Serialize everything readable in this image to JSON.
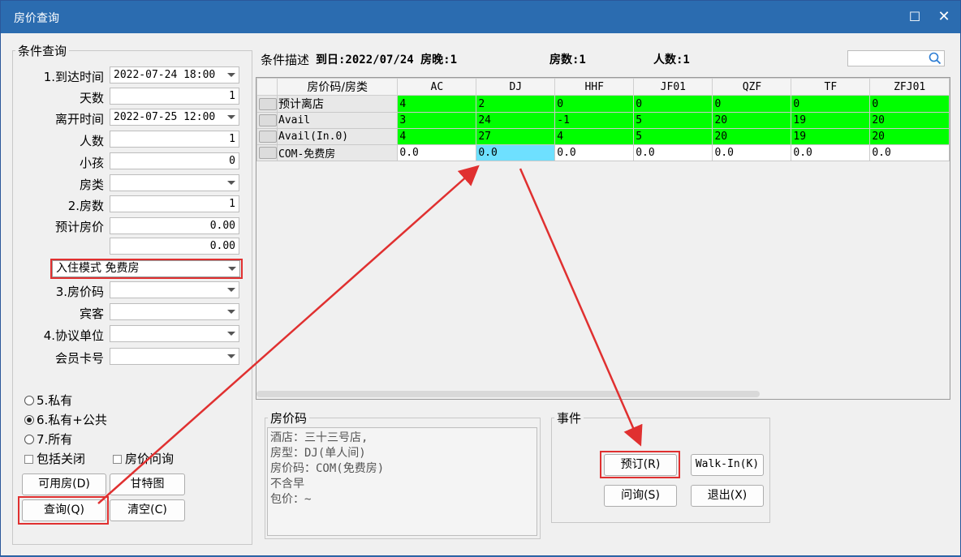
{
  "window": {
    "title": "房价查询"
  },
  "query": {
    "legend": "条件查询",
    "arrival_label": "1.到达时间",
    "arrival_value": "2022-07-24 18:00",
    "days_label": "天数",
    "days_value": "1",
    "depart_label": "离开时间",
    "depart_value": "2022-07-25 12:00",
    "persons_label": "人数",
    "persons_value": "1",
    "children_label": "小孩",
    "children_value": "0",
    "roomtype_label": "房类",
    "roomtype_value": "",
    "rooms_label": "2.房数",
    "rooms_value": "1",
    "estprice_label": "预计房价",
    "estprice_value": "0.00",
    "estprice2_value": "0.00",
    "checkin_mode": "入住模式 免费房",
    "ratecode_label": "3.房价码",
    "guest_label": "宾客",
    "agreement_label": "4.协议单位",
    "member_label": "会员卡号",
    "radio_private": "5.私有",
    "radio_private_public": "6.私有+公共",
    "radio_all": "7.所有",
    "chk_include_closed": "包括关闭",
    "chk_rate_query": "房价问询",
    "btn_available": "可用房(D)",
    "btn_gantt": "甘特图",
    "btn_query": "查询(Q)",
    "btn_clear": "清空(C)"
  },
  "condition": {
    "prefix": "条件描述",
    "desc": "到日:2022/07/24 房晚:1",
    "rooms": "房数:1",
    "persons": "人数:1",
    "search_placeholder": ""
  },
  "grid": {
    "header_first": "房价码/房类",
    "columns": [
      "AC",
      "DJ",
      "HHF",
      "JF01",
      "QZF",
      "TF",
      "ZFJ01"
    ],
    "rows": [
      {
        "name": "预计离店",
        "values": [
          "4",
          "2",
          "0",
          "0",
          "0",
          "0",
          "0"
        ]
      },
      {
        "name": "Avail",
        "values": [
          "3",
          "24",
          "-1",
          "5",
          "20",
          "19",
          "20"
        ]
      },
      {
        "name": "Avail(In.0)",
        "values": [
          "4",
          "27",
          "4",
          "5",
          "20",
          "19",
          "20"
        ]
      },
      {
        "name": "COM-免费房",
        "values": [
          "0.0",
          "0.0",
          "0.0",
          "0.0",
          "0.0",
          "0.0",
          "0.0"
        ]
      }
    ]
  },
  "ratecode": {
    "legend": "房价码",
    "lines": [
      "酒店：三十三号店,",
      "房型：DJ(单人间)",
      "房价码：COM(免费房)",
      "不含早",
      "包价：~"
    ]
  },
  "events": {
    "legend": "事件",
    "btn_book": "预订(R)",
    "btn_walkin": "Walk-In(K)",
    "btn_inquiry": "问询(S)",
    "btn_exit": "退出(X)"
  },
  "colors": {
    "available_cell": "#00ff00",
    "selected_cell": "#6ee0ff",
    "highlight_box": "#e03030",
    "titlebar": "#2b6cb0"
  }
}
